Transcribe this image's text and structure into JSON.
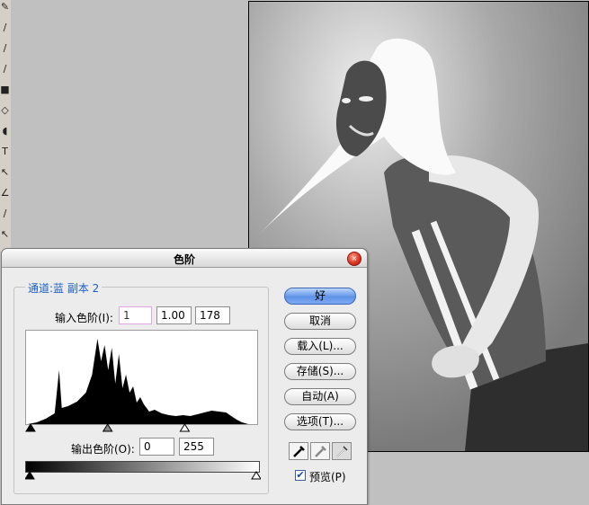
{
  "toolbox": {
    "tools": [
      {
        "name": "pencil-tool",
        "glyph": "✎"
      },
      {
        "name": "brush-tool",
        "glyph": "∕"
      },
      {
        "name": "stamp-tool",
        "glyph": "∕"
      },
      {
        "name": "history-brush-tool",
        "glyph": "∕"
      },
      {
        "name": "gradient-tool",
        "glyph": "■"
      },
      {
        "name": "blur-tool",
        "glyph": "◇"
      },
      {
        "name": "dodge-tool",
        "glyph": "◖"
      },
      {
        "name": "type-tool",
        "glyph": "T"
      },
      {
        "name": "path-selection-tool",
        "glyph": "↖"
      },
      {
        "name": "pen-tool",
        "glyph": "∠"
      },
      {
        "name": "eyedropper-tool",
        "glyph": "∕"
      },
      {
        "name": "hand-tool",
        "glyph": "↖"
      }
    ]
  },
  "dialog": {
    "title": "色阶",
    "close_glyph": "×",
    "channel_label": "通道:蓝 副本 2",
    "input_levels_label": "输入色阶(I):",
    "input_black": "1",
    "input_gamma": "1.00",
    "input_white": "178",
    "output_levels_label": "输出色阶(O):",
    "output_black": "0",
    "output_white": "255",
    "preview_label": "预览(P)",
    "preview_checked": "✔",
    "buttons": {
      "ok": "好",
      "cancel": "取消",
      "load": "载入(L)...",
      "save": "存储(S)...",
      "auto": "自动(A)",
      "options": "选项(T)..."
    },
    "eyedroppers": [
      "black-eyedropper-icon",
      "gray-eyedropper-icon",
      "white-eyedropper-icon"
    ]
  },
  "histogram_data": {
    "min_level": 0,
    "max_level": 255,
    "input_black_level": 1,
    "input_gamma": 1.0,
    "input_white_level": 178,
    "output_black_level": 0,
    "output_white_level": 255,
    "profile": [
      [
        0,
        0
      ],
      [
        10,
        2
      ],
      [
        20,
        6
      ],
      [
        30,
        12
      ],
      [
        35,
        60
      ],
      [
        38,
        18
      ],
      [
        45,
        20
      ],
      [
        55,
        25
      ],
      [
        65,
        35
      ],
      [
        72,
        55
      ],
      [
        78,
        95
      ],
      [
        82,
        70
      ],
      [
        86,
        88
      ],
      [
        90,
        60
      ],
      [
        94,
        85
      ],
      [
        98,
        45
      ],
      [
        102,
        78
      ],
      [
        106,
        40
      ],
      [
        110,
        55
      ],
      [
        114,
        35
      ],
      [
        118,
        42
      ],
      [
        122,
        24
      ],
      [
        126,
        30
      ],
      [
        130,
        22
      ],
      [
        136,
        14
      ],
      [
        142,
        16
      ],
      [
        150,
        12
      ],
      [
        158,
        10
      ],
      [
        166,
        9
      ],
      [
        174,
        10
      ],
      [
        182,
        9
      ],
      [
        190,
        11
      ],
      [
        198,
        13
      ],
      [
        206,
        15
      ],
      [
        214,
        14
      ],
      [
        222,
        13
      ],
      [
        228,
        9
      ],
      [
        234,
        5
      ],
      [
        240,
        2
      ],
      [
        247,
        0
      ],
      [
        255,
        0
      ]
    ]
  },
  "colors": {
    "channel_label": "#1c5fc4",
    "ok_button": "#5f93e6",
    "close_button": "#d8311e"
  }
}
